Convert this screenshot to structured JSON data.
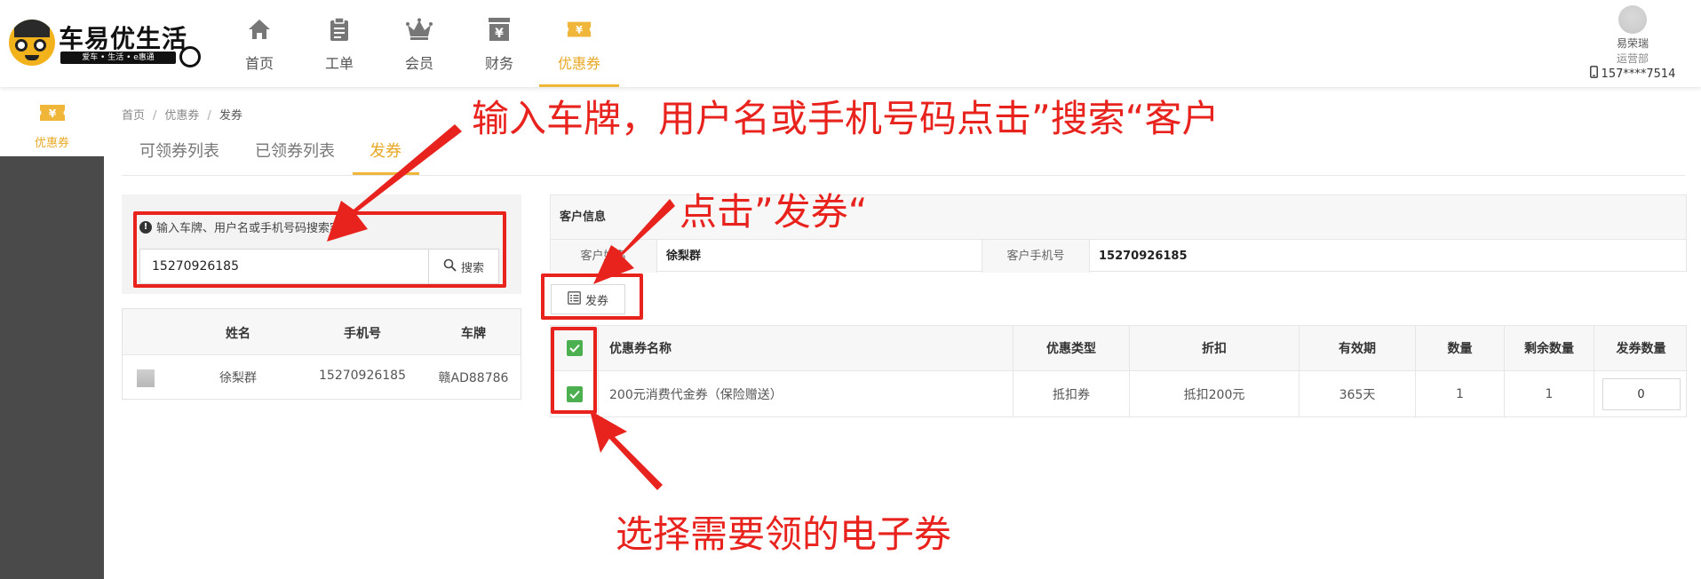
{
  "brand": {
    "name": "车易优生活",
    "tagline": "爱车 • 生活 • e惠通"
  },
  "nav": [
    {
      "label": "首页",
      "icon": "home-icon"
    },
    {
      "label": "工单",
      "icon": "clipboard-icon"
    },
    {
      "label": "会员",
      "icon": "crown-icon"
    },
    {
      "label": "财务",
      "icon": "finance-icon"
    },
    {
      "label": "优惠券",
      "icon": "coupon-icon",
      "active": true
    }
  ],
  "user": {
    "name": "易荣瑞",
    "dept": "运营部",
    "phone": "157****7514"
  },
  "sidebar": {
    "active_label": "优惠券"
  },
  "breadcrumb": [
    "首页",
    "优惠券",
    "发券"
  ],
  "tabs": [
    "可领券列表",
    "已领券列表",
    "发券"
  ],
  "search": {
    "hint": "输入车牌、用户名或手机号码搜索客户",
    "value": "15270926185",
    "button_label": "搜索"
  },
  "customer_table": {
    "headers": [
      "姓名",
      "手机号",
      "车牌"
    ],
    "rows": [
      {
        "name": "徐梨群",
        "phone": "15270926185",
        "plate": "赣AD88786"
      }
    ]
  },
  "customer_info": {
    "title": "客户信息",
    "name_label": "客户姓名",
    "name_value": "徐梨群",
    "phone_label": "客户手机号",
    "phone_value": "15270926185"
  },
  "issue_button_label": "发券",
  "coupon_table": {
    "headers": [
      "优惠券名称",
      "优惠类型",
      "折扣",
      "有效期",
      "数量",
      "剩余数量",
      "发券数量"
    ],
    "rows": [
      {
        "name": "200元消费代金券（保险赠送）",
        "type": "抵扣券",
        "discount": "抵扣200元",
        "validity": "365天",
        "qty": "1",
        "remaining": "1",
        "issue_qty": "0"
      }
    ]
  },
  "annotations": {
    "search": "输入车牌，用户名或手机号码点击”搜索“客户",
    "issue": "点击”发券“",
    "select": "选择需要领的电子券"
  },
  "colors": {
    "accent": "#f0b63a",
    "annotation_red": "#e8231e",
    "check_green": "#4caf50",
    "sidebar": "#4a4a4a"
  }
}
